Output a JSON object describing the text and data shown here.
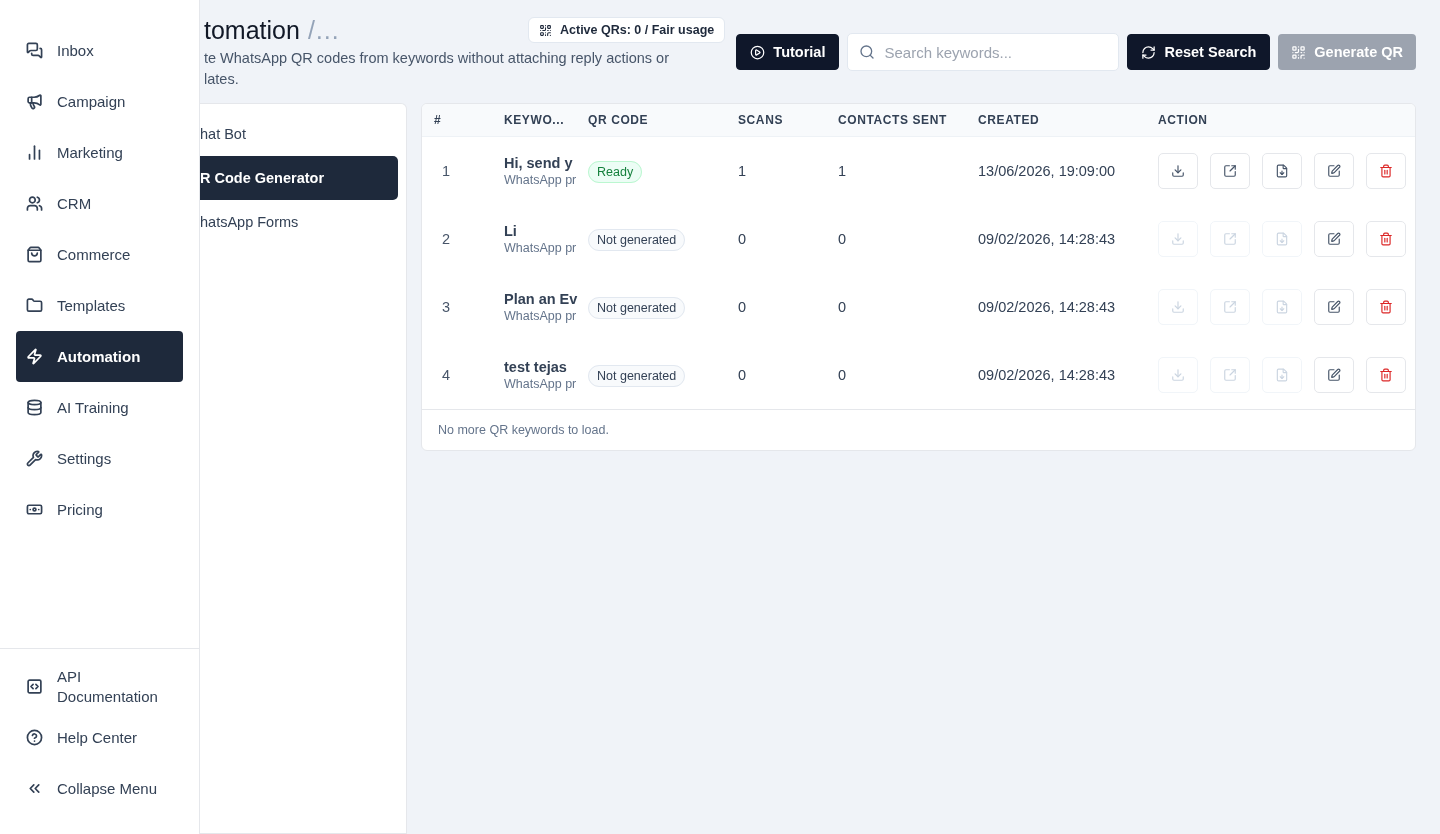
{
  "sidebar": {
    "items": [
      {
        "kind": "inbox",
        "label": "Inbox",
        "selected": false
      },
      {
        "kind": "campaign",
        "label": "Campaign",
        "selected": false
      },
      {
        "kind": "marketing",
        "label": "Marketing",
        "selected": false
      },
      {
        "kind": "crm",
        "label": "CRM",
        "selected": false
      },
      {
        "kind": "commerce",
        "label": "Commerce",
        "selected": false
      },
      {
        "kind": "templates",
        "label": "Templates",
        "selected": false
      },
      {
        "kind": "automation",
        "label": "Automation",
        "selected": true
      },
      {
        "kind": "ai",
        "label": "AI Training",
        "selected": false
      },
      {
        "kind": "settings",
        "label": "Settings",
        "selected": false
      },
      {
        "kind": "pricing",
        "label": "Pricing",
        "selected": false
      }
    ],
    "footer_items": [
      {
        "kind": "api",
        "label": "API Documentation"
      },
      {
        "kind": "help",
        "label": "Help Center"
      },
      {
        "kind": "collapse",
        "label": "Collapse Menu"
      }
    ]
  },
  "header": {
    "title": "tomation",
    "crumb": "/…",
    "subtitle_lines": [
      "te WhatsApp QR codes from keywords without attaching reply actions or",
      "lates."
    ],
    "usage_badge": "Active QRs: 0 / Fair usage"
  },
  "toolbar": {
    "tutorial": "Tutorial",
    "search": {
      "placeholder": "Search keywords..."
    },
    "reset": "Reset Search",
    "generate": {
      "label": "Generate QR",
      "disabled": true
    }
  },
  "subnav": [
    {
      "label": "hat Bot",
      "selected": false
    },
    {
      "label": "R Code Generator",
      "selected": true
    },
    {
      "label": "hatsApp Forms",
      "selected": false
    }
  ],
  "table": {
    "columns": [
      "#",
      "KEYWO...",
      "QR CODE",
      "SCANS",
      "CONTACTS SENT",
      "CREATED",
      "ACTION"
    ],
    "rows": [
      {
        "index": "1",
        "keyword": "Hi, send y",
        "detail": "WhatsApp pr",
        "ready": true,
        "status_label": "Ready",
        "scans": "1",
        "contacts": "1",
        "created": "13/06/2026, 19:09:00",
        "actions": [
          {
            "kind": "download",
            "disabled": false
          },
          {
            "kind": "open",
            "disabled": false
          },
          {
            "kind": "file",
            "disabled": false
          },
          {
            "kind": "edit",
            "disabled": false
          },
          {
            "kind": "delete",
            "disabled": false
          }
        ]
      },
      {
        "index": "2",
        "keyword": "Li",
        "detail": "WhatsApp pr",
        "ready": false,
        "status_label": "Not generated",
        "scans": "0",
        "contacts": "0",
        "created": "09/02/2026, 14:28:43",
        "actions": [
          {
            "kind": "download",
            "disabled": true
          },
          {
            "kind": "open",
            "disabled": true
          },
          {
            "kind": "file",
            "disabled": true
          },
          {
            "kind": "edit",
            "disabled": false
          },
          {
            "kind": "delete",
            "disabled": false
          }
        ]
      },
      {
        "index": "3",
        "keyword": "Plan an Ev",
        "detail": "WhatsApp pr",
        "ready": false,
        "status_label": "Not generated",
        "scans": "0",
        "contacts": "0",
        "created": "09/02/2026, 14:28:43",
        "actions": [
          {
            "kind": "download",
            "disabled": true
          },
          {
            "kind": "open",
            "disabled": true
          },
          {
            "kind": "file",
            "disabled": true
          },
          {
            "kind": "edit",
            "disabled": false
          },
          {
            "kind": "delete",
            "disabled": false
          }
        ]
      },
      {
        "index": "4",
        "keyword": "test tejas",
        "detail": "WhatsApp pr",
        "ready": false,
        "status_label": "Not generated",
        "scans": "0",
        "contacts": "0",
        "created": "09/02/2026, 14:28:43",
        "actions": [
          {
            "kind": "download",
            "disabled": true
          },
          {
            "kind": "open",
            "disabled": true
          },
          {
            "kind": "file",
            "disabled": true
          },
          {
            "kind": "edit",
            "disabled": false
          },
          {
            "kind": "delete",
            "disabled": false
          }
        ]
      }
    ],
    "footer": "No more QR keywords to load."
  }
}
